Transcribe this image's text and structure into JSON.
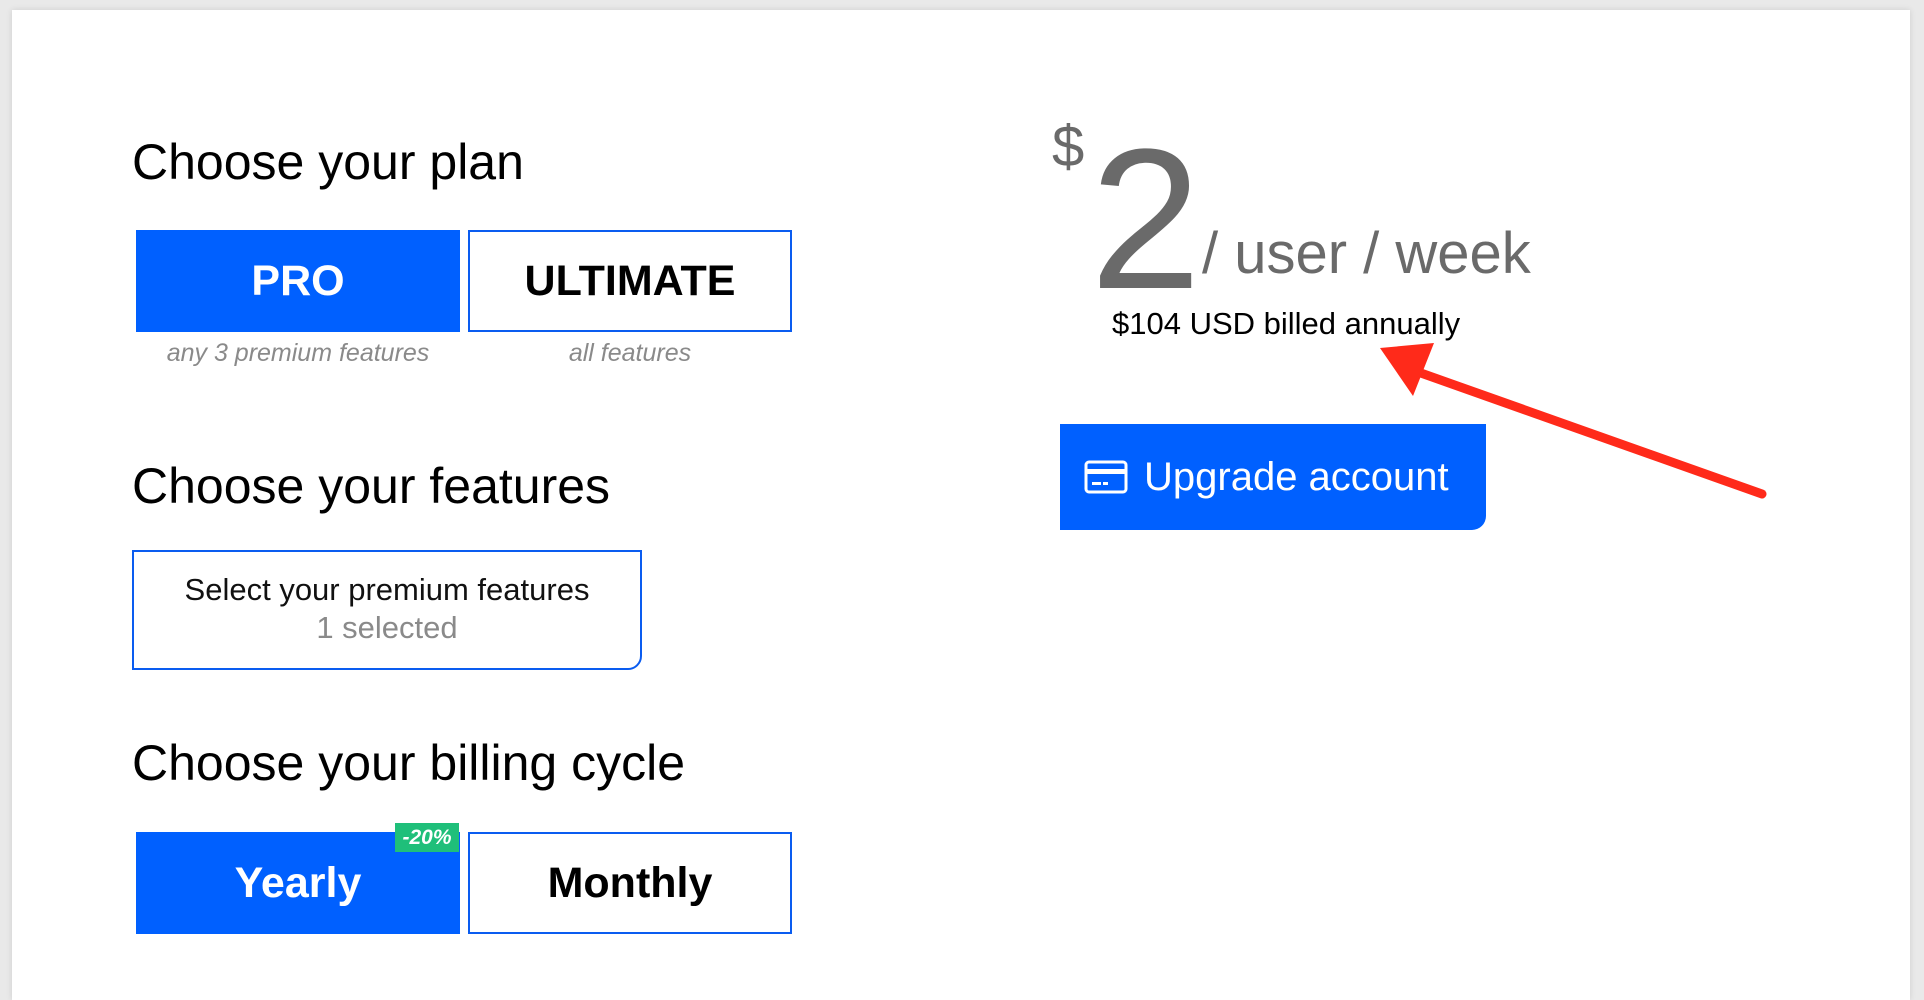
{
  "plan": {
    "heading": "Choose your plan",
    "options": [
      {
        "label": "PRO",
        "caption": "any 3 premium features",
        "selected": true
      },
      {
        "label": "ULTIMATE",
        "caption": "all features",
        "selected": false
      }
    ]
  },
  "features": {
    "heading": "Choose your features",
    "selector_title": "Select your premium features",
    "selector_count": "1 selected"
  },
  "billing": {
    "heading": "Choose your billing cycle",
    "options": [
      {
        "label": "Yearly",
        "badge": "-20%",
        "selected": true
      },
      {
        "label": "Monthly",
        "selected": false
      }
    ]
  },
  "pricing": {
    "currency_symbol": "$",
    "amount": "2",
    "unit": "/ user / week",
    "billing_note": "$104 USD billed annually"
  },
  "upgrade": {
    "label": "Upgrade account",
    "icon": "credit-card-icon"
  },
  "colors": {
    "primary": "#0060ff",
    "border": "#0a5cf0",
    "badge": "#1fbf7a",
    "muted_text": "#8a8a8a",
    "price_text": "#6a6a6a",
    "annotation_arrow": "#ff2a1a"
  }
}
